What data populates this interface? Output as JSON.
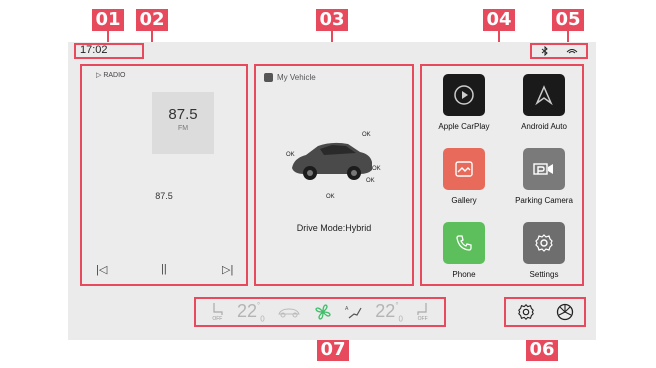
{
  "status_bar": {
    "time": "17:02",
    "icons": [
      "bluetooth-icon",
      "signal-icon"
    ]
  },
  "radio": {
    "header": "▷ RADIO",
    "frequency": "87.5",
    "band": "FM",
    "current_station": "87.5",
    "controls": {
      "prev": "|◁",
      "pause": "||",
      "next": "▷|"
    }
  },
  "vehicle": {
    "header": "My Vehicle",
    "status_labels": [
      "OK",
      "OK",
      "OK",
      "OK",
      "OK"
    ],
    "drive_mode": "Drive Mode:Hybrid"
  },
  "apps": [
    {
      "label": "Apple CarPlay",
      "color": "#1a1a1a",
      "icon": "carplay-icon"
    },
    {
      "label": "Android Auto",
      "color": "#1a1a1a",
      "icon": "android-auto-icon"
    },
    {
      "label": "Gallery",
      "color": "#e86a5a",
      "icon": "gallery-icon"
    },
    {
      "label": "Parking Camera",
      "color": "#7a7a7a",
      "icon": "parking-camera-icon"
    },
    {
      "label": "Phone",
      "color": "#5cbf5c",
      "icon": "phone-icon"
    },
    {
      "label": "Settings",
      "color": "#6e6e6e",
      "icon": "settings-icon"
    }
  ],
  "climate": {
    "left_seat": "OFF",
    "left_temp": "22",
    "left_temp_decimal": "0",
    "right_temp": "22",
    "right_temp_decimal": "0",
    "right_seat": "OFF",
    "fan_color": "#3fbf6a"
  },
  "callouts": [
    "01",
    "02",
    "03",
    "04",
    "05",
    "06",
    "07"
  ],
  "accent_color": "#e64a5c"
}
